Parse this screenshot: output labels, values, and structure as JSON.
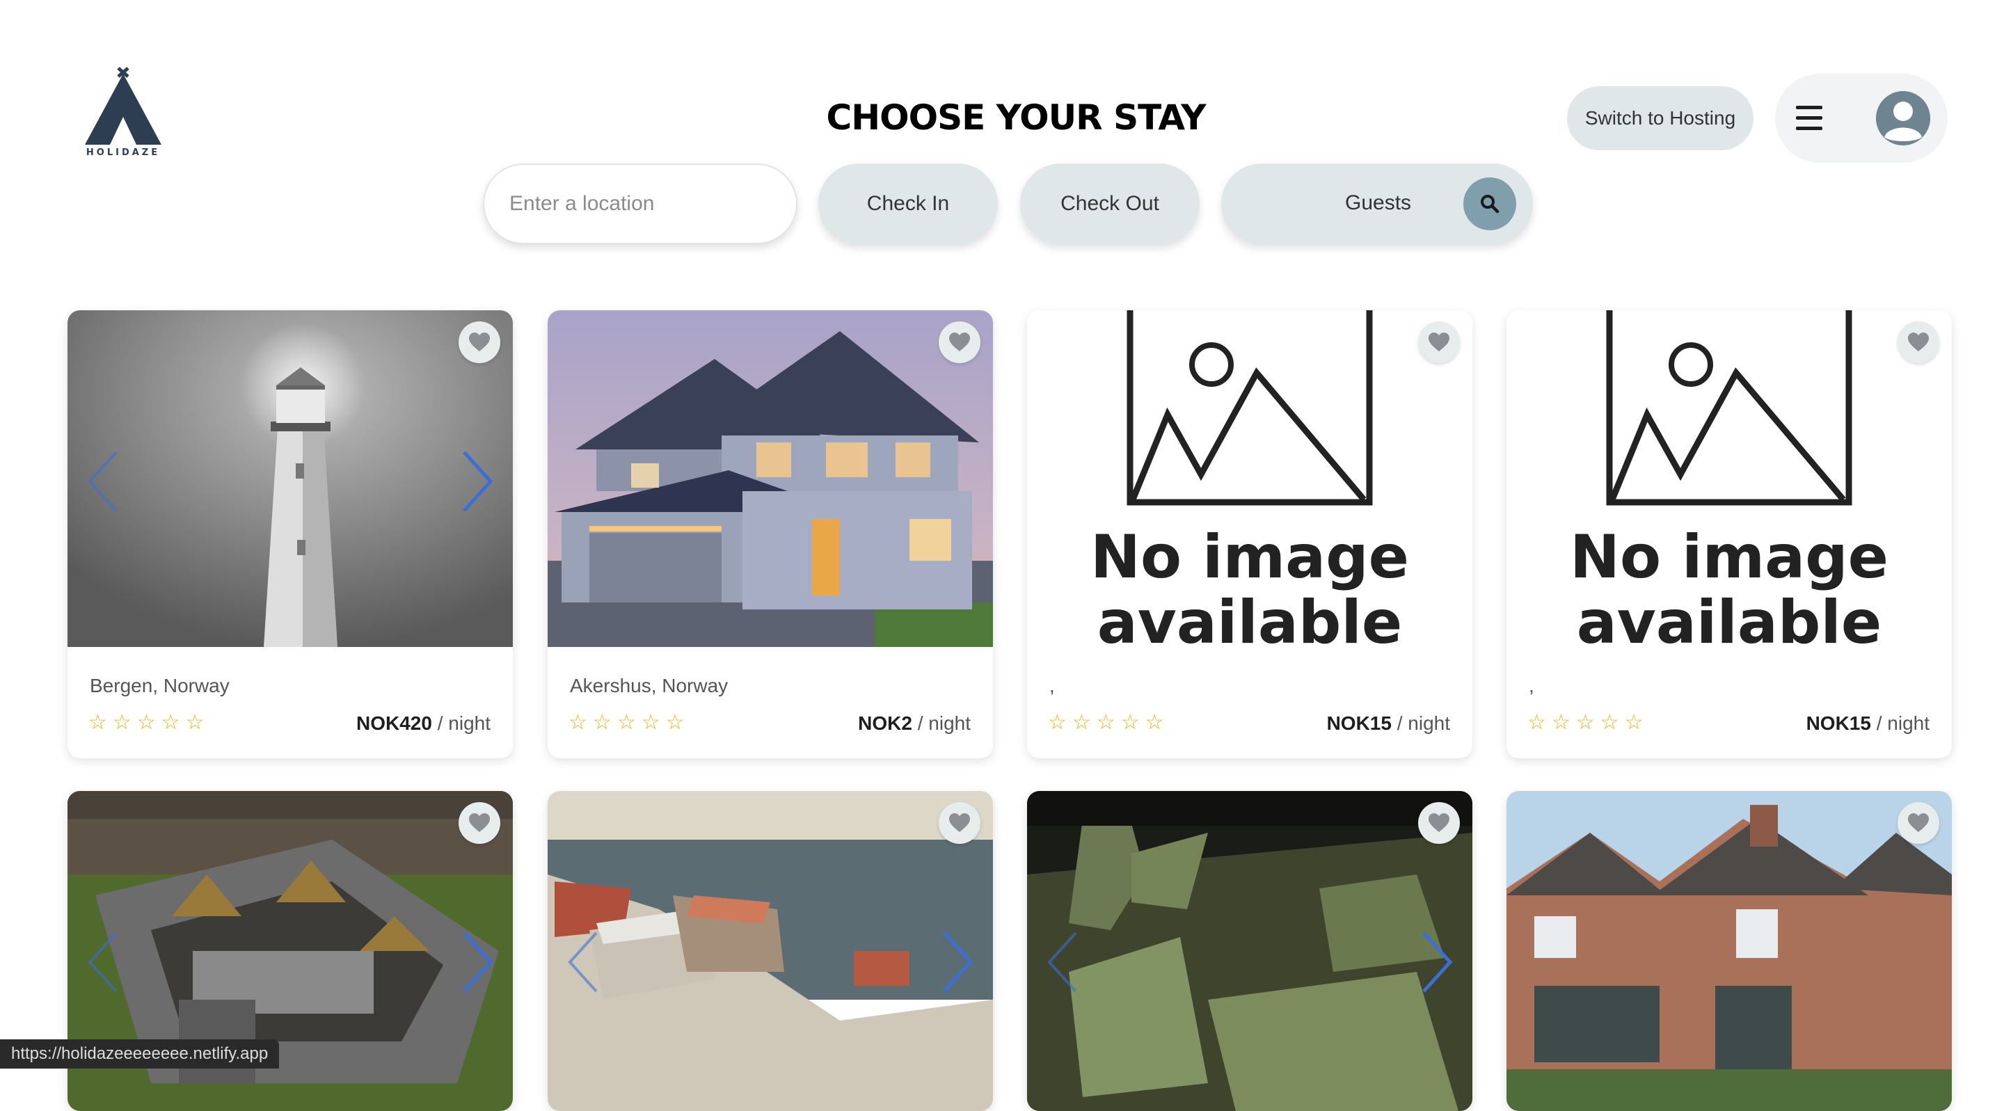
{
  "brand": {
    "logo_text": "HOLIDAZE"
  },
  "page_title": "CHOOSE YOUR STAY",
  "search": {
    "location_placeholder": "Enter a location",
    "check_in_label": "Check In",
    "check_out_label": "Check Out",
    "guests_label": "Guests"
  },
  "header": {
    "switch_hosting_label": "Switch to Hosting",
    "menu_icon": "hamburger-icon",
    "avatar_icon": "user-icon"
  },
  "colors": {
    "pill_bg": "#dfe7e9",
    "search_btn": "#7e9fab",
    "arrow_blue": "#3b6fd6",
    "star_gold": "#e7b51c",
    "heart_grey": "#8b8f93"
  },
  "listings": [
    {
      "location": "Bergen, Norway",
      "price": "NOK420",
      "unit": "/ night",
      "rating_stars": 5,
      "rating_filled": 0,
      "image": "lighthouse"
    },
    {
      "location": "Akershus, Norway",
      "price": "NOK2",
      "unit": "/ night",
      "rating_stars": 5,
      "rating_filled": 0,
      "image": "house"
    },
    {
      "location": ",",
      "price": "NOK15",
      "unit": "/ night",
      "rating_stars": 5,
      "rating_filled": 0,
      "image": "no-image",
      "no_image_text": "No image available"
    },
    {
      "location": ",",
      "price": "NOK15",
      "unit": "/ night",
      "rating_stars": 5,
      "rating_filled": 0,
      "image": "no-image",
      "no_image_text": "No image available"
    },
    {
      "image": "castle"
    },
    {
      "image": "coastal-town"
    },
    {
      "image": "swamp-ruins"
    },
    {
      "image": "brick-house"
    }
  ],
  "status_url": "https://holidazeeeeeeee.netlify.app"
}
